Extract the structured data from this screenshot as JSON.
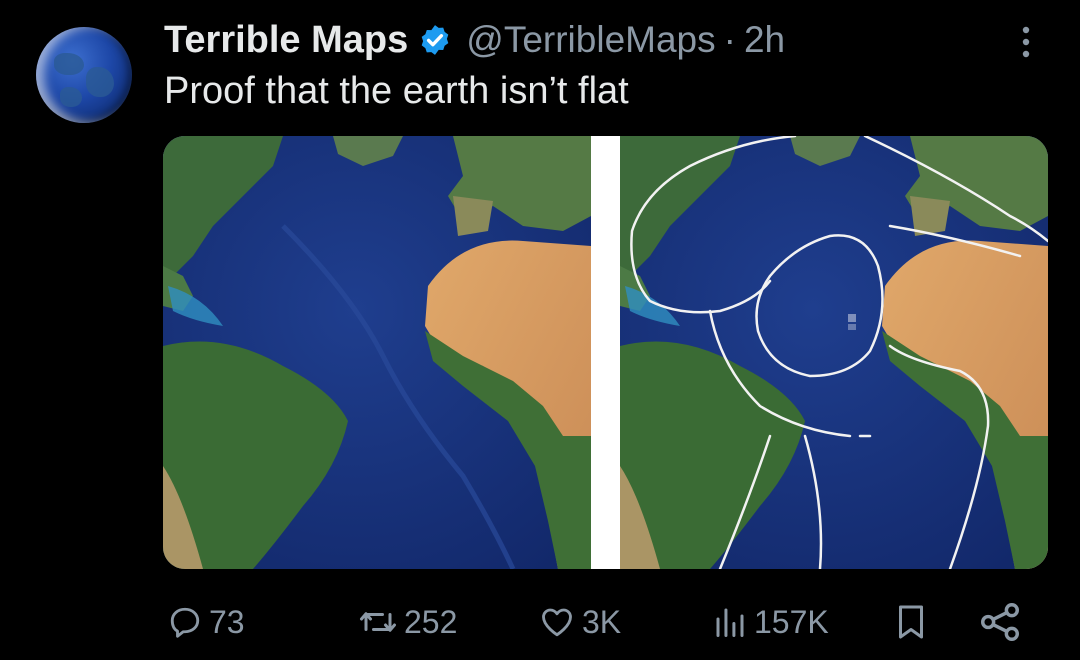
{
  "tweet": {
    "display_name": "Terrible Maps",
    "handle": "@TerribleMaps",
    "separator": "·",
    "time": "2h",
    "text": "Proof that the earth isn’t flat"
  },
  "actions": {
    "replies": "73",
    "reposts": "252",
    "likes": "3K",
    "views": "157K"
  },
  "colors": {
    "verified": "#1d9bf0",
    "muted": "#8b98a5",
    "text": "#e7e9ea",
    "background": "#000000"
  },
  "icons": {
    "verified": "verified-badge-icon",
    "more": "more-vertical-icon",
    "reply": "reply-icon",
    "repost": "repost-icon",
    "like": "heart-icon",
    "views": "views-icon",
    "bookmark": "bookmark-icon",
    "share": "share-icon"
  }
}
